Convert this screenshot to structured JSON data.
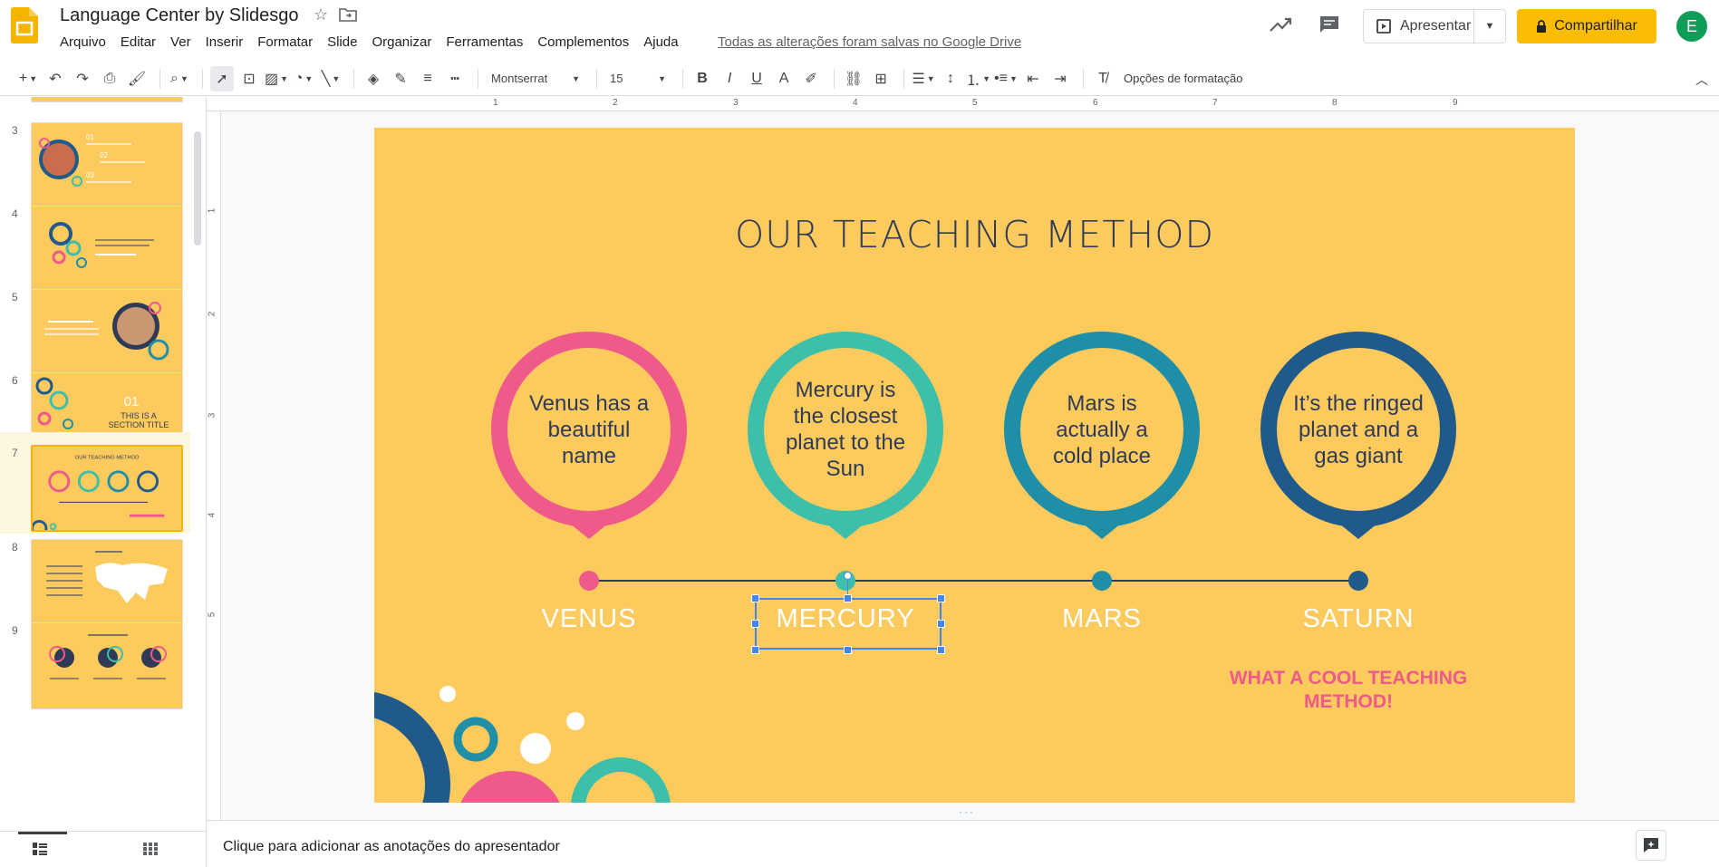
{
  "app": {
    "title": "Language Center by Slidesgo",
    "save_status": "Todas as alterações foram salvas no Google Drive",
    "present_label": "Apresentar",
    "share_label": "Compartilhar",
    "avatar_initial": "E"
  },
  "menu": [
    "Arquivo",
    "Editar",
    "Ver",
    "Inserir",
    "Formatar",
    "Slide",
    "Organizar",
    "Ferramentas",
    "Complementos",
    "Ajuda"
  ],
  "toolbar": {
    "font": "Montserrat",
    "size": "15",
    "format_options": "Opções de formatação"
  },
  "filmstrip": {
    "slides": [
      {
        "num": "3"
      },
      {
        "num": "4"
      },
      {
        "num": "5"
      },
      {
        "num": "6"
      },
      {
        "num": "7"
      },
      {
        "num": "8"
      },
      {
        "num": "9"
      }
    ],
    "active": "7"
  },
  "ruler": {
    "top": [
      "1",
      "2",
      "3",
      "4",
      "5",
      "6",
      "7",
      "8",
      "9"
    ],
    "left": [
      "1",
      "2",
      "3",
      "4",
      "5"
    ]
  },
  "slide": {
    "title": "OUR TEACHING METHOD",
    "pins": [
      {
        "text": "Venus has a beautiful name",
        "color": "#ef5a8a"
      },
      {
        "text": "Mercury is the closest planet to the Sun",
        "color": "#3dbfaa"
      },
      {
        "text": "Mars is actually a cold place",
        "color": "#1f8fa8"
      },
      {
        "text": "It’s the ringed planet and a gas giant",
        "color": "#1f5a8a"
      }
    ],
    "labels": [
      "VENUS",
      "MERCURY",
      "MARS",
      "SATURN"
    ],
    "cool_text": "WHAT A COOL TEACHING METHOD!"
  },
  "notes_placeholder": "Clique para adicionar as anotações do apresentador"
}
